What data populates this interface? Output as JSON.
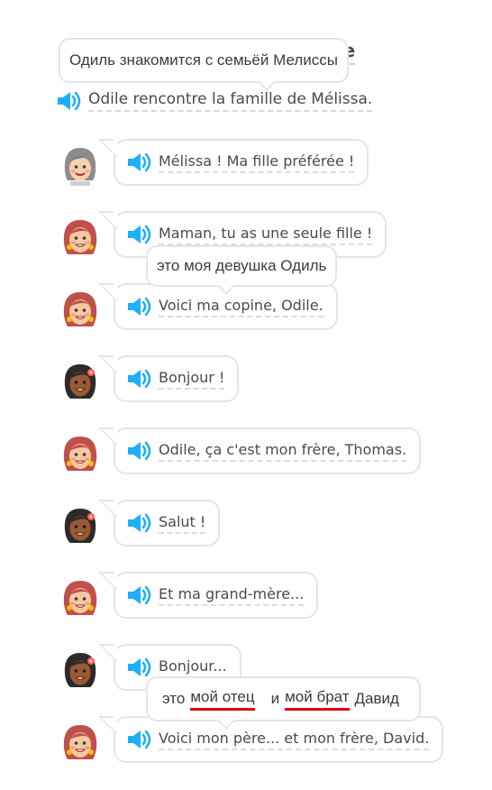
{
  "title_hidden": "ille",
  "tooltips": {
    "title": "Одиль знакомится с семьёй Мелиссы",
    "line3": "это моя девушка Одиль",
    "last": {
      "w1": "это",
      "w2": "мой отец",
      "w3": "и",
      "w4": "мой брат",
      "w5": "Давид"
    }
  },
  "headline": "Odile rencontre la famille de Mélissa.",
  "lines": [
    {
      "speaker": "grandmother",
      "text": "Mélissa ! Ma fille préférée !"
    },
    {
      "speaker": "melissa",
      "text": "Maman, tu as une seule fille !"
    },
    {
      "speaker": "melissa",
      "text": "Voici ma copine, Odile."
    },
    {
      "speaker": "odile",
      "text": "Bonjour !"
    },
    {
      "speaker": "melissa",
      "text": "Odile, ça c'est mon frère, Thomas."
    },
    {
      "speaker": "odile",
      "text": "Salut !"
    },
    {
      "speaker": "melissa",
      "text": "Et ma grand-mère..."
    },
    {
      "speaker": "odile",
      "text": "Bonjour..."
    },
    {
      "speaker": "melissa",
      "text": "Voici mon père... et mon frère, David."
    }
  ],
  "colors": {
    "speaker_blue": "#1cb0f6",
    "underline_red": "#e0001b",
    "border_gray": "#e5e5e5"
  }
}
